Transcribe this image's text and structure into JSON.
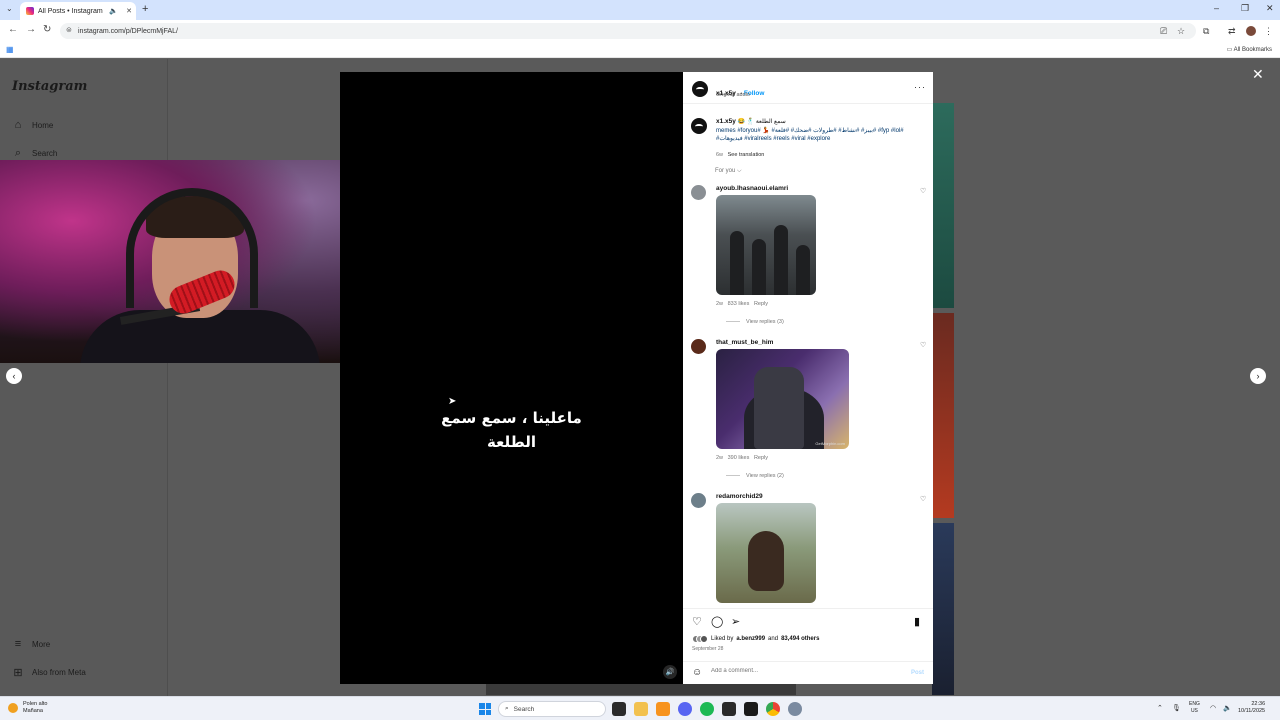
{
  "browser": {
    "tab_title": "All Posts • Instagram",
    "url": "instagram.com/p/DPlecmMjFAL/",
    "all_bookmarks": "All Bookmarks"
  },
  "sidebar": {
    "logo": "Instagram",
    "items": [
      {
        "label": "Home",
        "icon": "home-icon"
      },
      {
        "label": "Search",
        "icon": "search-icon"
      },
      {
        "label": "More",
        "icon": "menu-icon"
      },
      {
        "label": "Also from Meta",
        "icon": "meta-icon"
      }
    ]
  },
  "video": {
    "overlay_text_line1": "ماعلينا ، سمع سمع",
    "overlay_text_line2": "الطلعة"
  },
  "post": {
    "username": "x1.x5y",
    "follow_label": "Follow",
    "audio": "Original audio",
    "caption_user": "x1.x5y",
    "caption_text": "😂 🕺 سمع الطلعة",
    "caption_tags": "memes #foryou# 💃 #بيبز# #نشاط# #طرولات #ضحك# #فلعة# #fyp #lol# #فيديوهات #viralreels #reels #viral #explore",
    "caption_age": "6w",
    "see_translation": "See translation",
    "for_you": "For you ⌵"
  },
  "comments": [
    {
      "user": "ayoub.lhasnaoui.elamri",
      "age": "2w",
      "likes": "833 likes",
      "reply": "Reply",
      "view_replies": "View replies (3)"
    },
    {
      "user": "that_must_be_him",
      "age": "2w",
      "likes": "390 likes",
      "reply": "Reply",
      "view_replies": "View replies (2)",
      "watermark": "GetMorphin.com"
    },
    {
      "user": "redamorchid29"
    }
  ],
  "actions": {
    "liked_by_prefix": "Liked by",
    "liked_by_user": "a.benz999",
    "liked_by_and": "and",
    "liked_by_others": "83,494 others",
    "date": "September 28",
    "comment_placeholder": "Add a comment...",
    "post_label": "Post"
  },
  "taskbar": {
    "weather_line1": "Polen alto",
    "weather_line2": "Mañana",
    "search_label": "Search",
    "lang_line1": "ENG",
    "lang_line2": "US",
    "time": "22:36",
    "date": "10/11/2025"
  }
}
